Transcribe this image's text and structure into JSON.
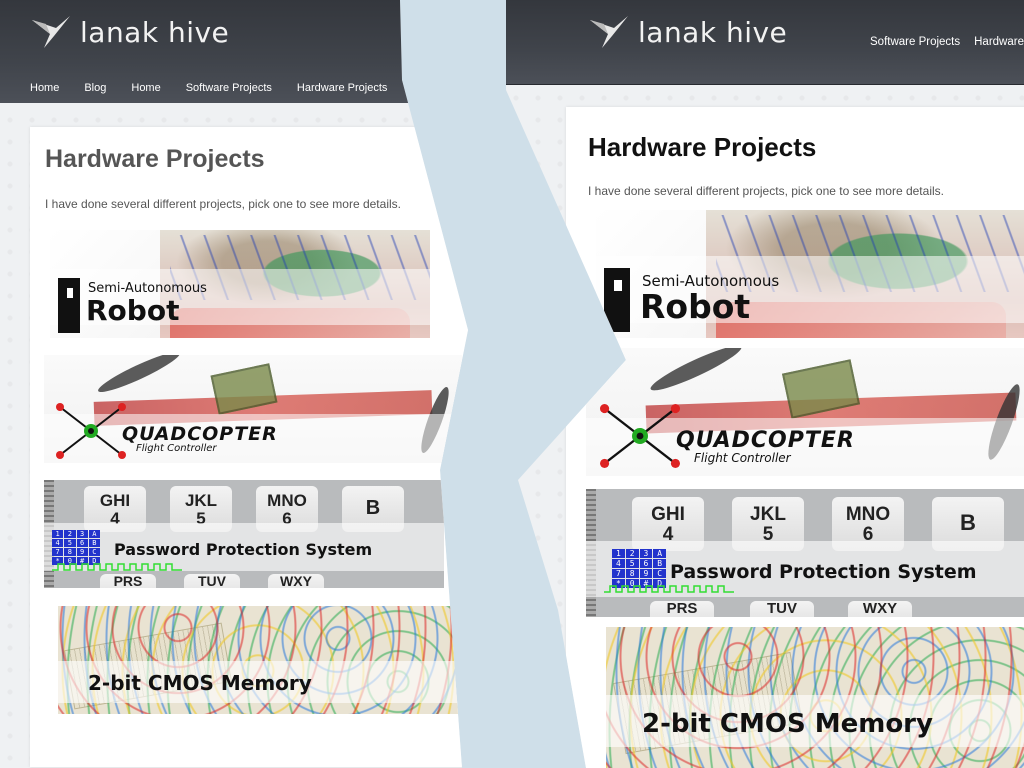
{
  "site": {
    "logo_text": "lanak hive"
  },
  "left": {
    "nav": [
      "Home",
      "Blog",
      "Home",
      "Software Projects",
      "Hardware Projects"
    ]
  },
  "right": {
    "nav": [
      "Software Projects",
      "Hardware"
    ]
  },
  "page": {
    "title": "Hardware Projects",
    "intro": "I have done several different projects, pick one to see more details."
  },
  "projects": {
    "robot": {
      "line1": "Semi-Autonomous",
      "line2": "Robot"
    },
    "quadcopter": {
      "title": "QUADCOPTER",
      "subtitle": "Flight Controller"
    },
    "password": {
      "title": "Password Protection System",
      "keys": [
        "GHI",
        "4",
        "JKL",
        "5",
        "MNO",
        "6",
        "B",
        "PRS",
        "TUV",
        "WXY"
      ],
      "grid": [
        "1",
        "2",
        "3",
        "A",
        "4",
        "5",
        "6",
        "B",
        "7",
        "8",
        "9",
        "C",
        "*",
        "0",
        "#",
        "D"
      ]
    },
    "cmos": {
      "title": "2-bit CMOS Memory"
    }
  },
  "colors": {
    "header": "#40444b",
    "divider": "#cfdfe9",
    "keypad_grid": "#2233cc",
    "wave": "#33dd33"
  }
}
